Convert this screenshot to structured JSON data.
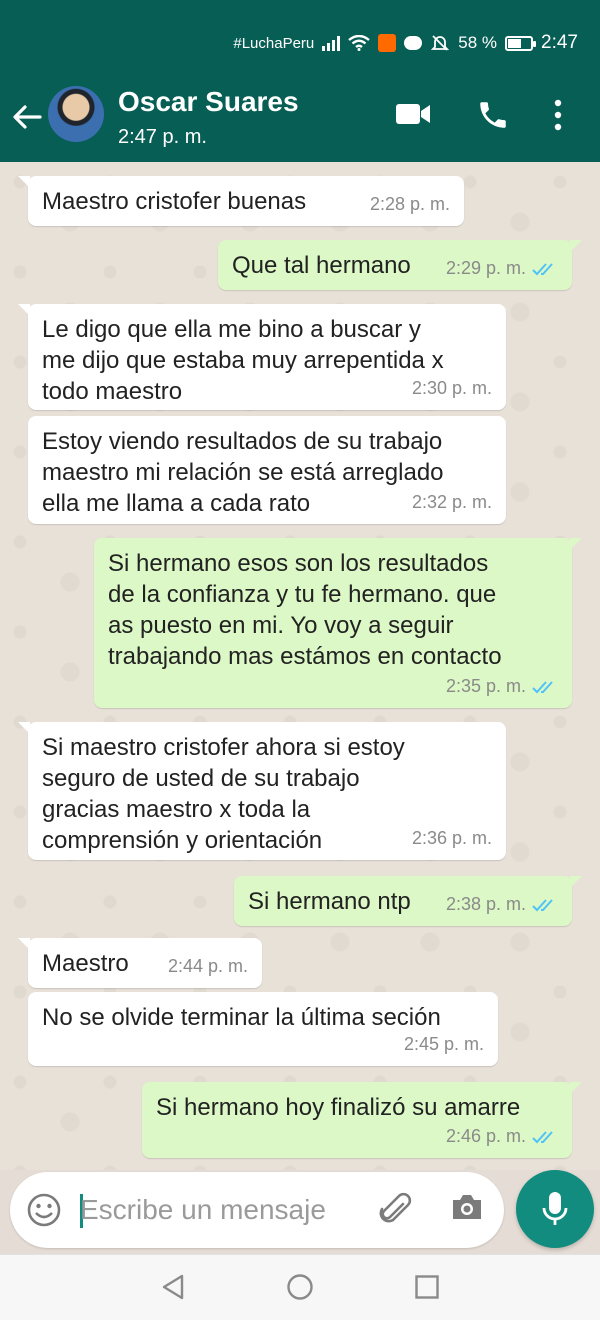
{
  "status_bar": {
    "carrier": "#LuchaPeru",
    "battery": "58 %",
    "battery_level": 0.58,
    "time": "2:47"
  },
  "header": {
    "contact_name": "Oscar Suares",
    "contact_status": "2:47 p. m."
  },
  "messages": [
    {
      "dir": "in",
      "text": "Maestro  cristofer buenas",
      "time": "2:28 p. m."
    },
    {
      "dir": "out",
      "text": "Que tal hermano",
      "time": "2:29 p. m."
    },
    {
      "dir": "in",
      "text": "Le digo que ella me bino  a buscar y\nme dijo que estaba muy arrepentida  x\ntodo maestro",
      "time": "2:30 p. m."
    },
    {
      "dir": "in",
      "text": "Estoy viendo resultados de su trabajo\nmaestro mi relación se está arreglado\nella me llama  a cada  rato",
      "time": "2:32 p. m."
    },
    {
      "dir": "out",
      "text": "Si hermano esos son los resultados\nde la confianza y tu fe hermano. que\nas puesto en mi. Yo voy a seguir\ntrabajando mas estámos en contacto",
      "time": "2:35 p. m."
    },
    {
      "dir": "in",
      "text": "Si maestro cristofer ahora si estoy\nseguro  de usted  de su trabajo\ngracias maestro x toda la\ncomprensión y orientación",
      "time": "2:36 p. m."
    },
    {
      "dir": "out",
      "text": "Si hermano ntp",
      "time": "2:38 p. m."
    },
    {
      "dir": "in",
      "text": "Maestro",
      "time": "2:44 p. m."
    },
    {
      "dir": "in",
      "text": "No se olvide terminar la última seción",
      "time": "2:45 p. m."
    },
    {
      "dir": "out",
      "text": "Si hermano hoy finalizó su amarre",
      "time": "2:46 p. m."
    }
  ],
  "composer": {
    "placeholder": "Escribe un mensaje"
  },
  "colors": {
    "header": "#075e54",
    "outgoing_bubble": "#dcf8c6",
    "incoming_bubble": "#ffffff",
    "accent": "#128c7e",
    "read_ticks": "#4fc3f7"
  },
  "icons": [
    "back-arrow-icon",
    "video-call-icon",
    "phone-icon",
    "more-options-icon",
    "emoji-icon",
    "attach-icon",
    "camera-icon",
    "mic-icon",
    "double-check-icon"
  ]
}
